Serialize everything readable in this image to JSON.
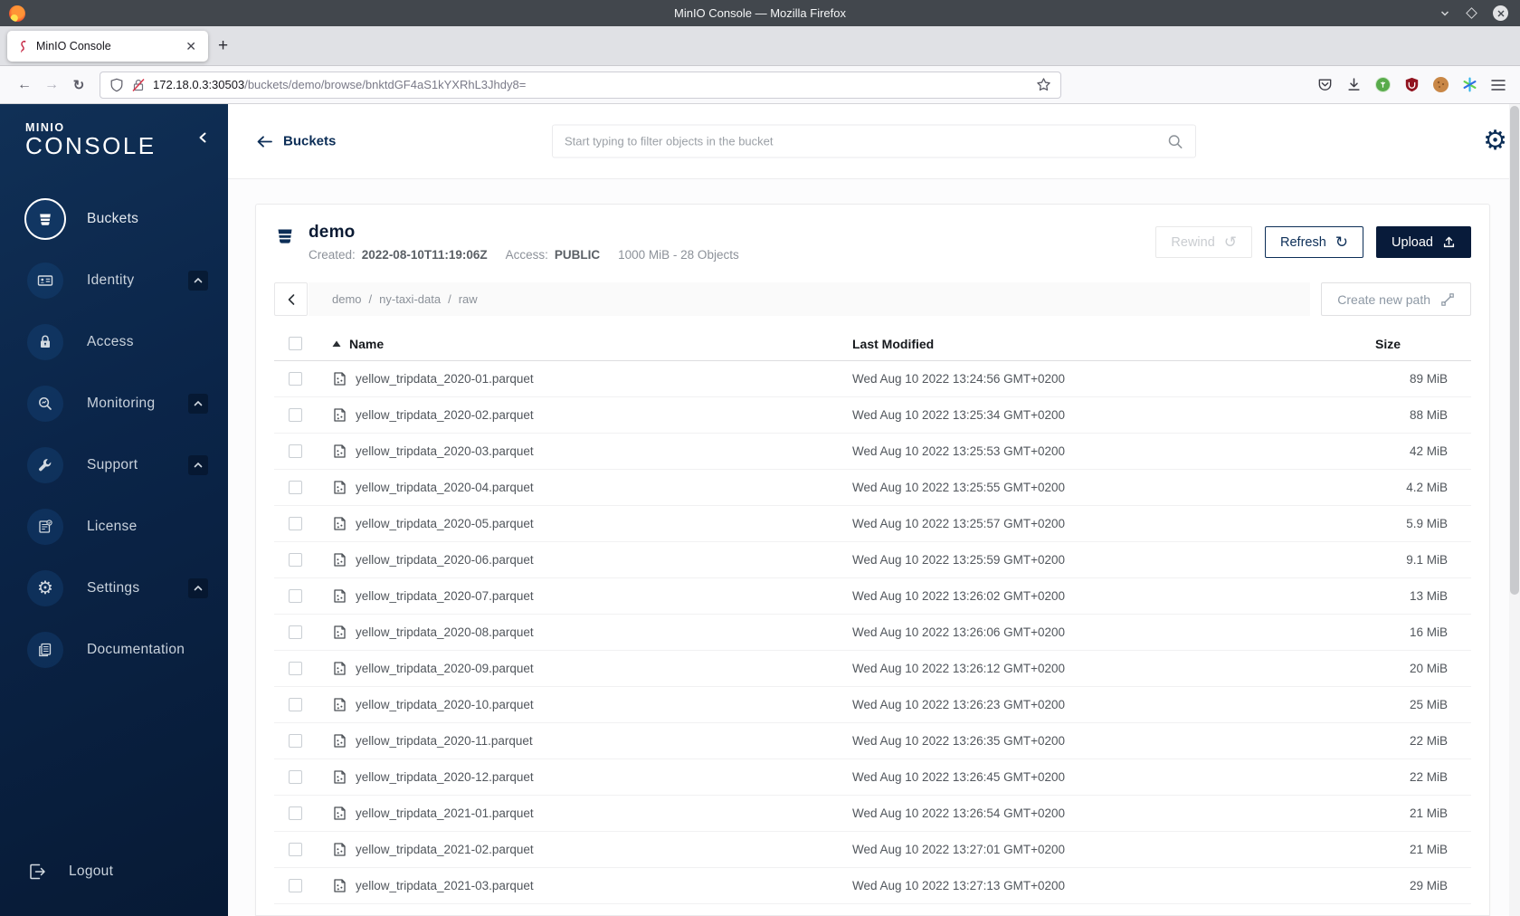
{
  "window": {
    "title": "MinIO Console — Mozilla Firefox"
  },
  "browser": {
    "tab_title": "MinIO Console",
    "url_host": "172.18.0.3:30503",
    "url_path": "/buckets/demo/browse/bnktdGF4aS1kYXRhL3Jhdy8=",
    "toolbar_icon_names": [
      "shield-permissions",
      "insecure-lock",
      "bookmark-star",
      "save-to-pocket",
      "downloads",
      "green-extension",
      "ublock-origin-extension",
      "cookie-extension",
      "sparkle-extension",
      "open-application-menu"
    ]
  },
  "sidebar": {
    "logo_line1": "MINIO",
    "logo_line2": "CONSOLE",
    "items": [
      {
        "label": "Buckets",
        "icon": "bucket-icon",
        "active": true,
        "expandable": false
      },
      {
        "label": "Identity",
        "icon": "id-card-icon",
        "active": false,
        "expandable": true
      },
      {
        "label": "Access",
        "icon": "lock-icon",
        "active": false,
        "expandable": false
      },
      {
        "label": "Monitoring",
        "icon": "monitor-magnifier-icon",
        "active": false,
        "expandable": true
      },
      {
        "label": "Support",
        "icon": "wrench-icon",
        "active": false,
        "expandable": true
      },
      {
        "label": "License",
        "icon": "license-doc-icon",
        "active": false,
        "expandable": false
      },
      {
        "label": "Settings",
        "icon": "gear-icon",
        "active": false,
        "expandable": true
      },
      {
        "label": "Documentation",
        "icon": "documentation-icon",
        "active": false,
        "expandable": false
      }
    ],
    "logout_label": "Logout"
  },
  "header": {
    "back_label": "Buckets",
    "search_placeholder": "Start typing to filter objects in the bucket"
  },
  "bucket": {
    "name": "demo",
    "created_label": "Created:",
    "created_value": "2022-08-10T11:19:06Z",
    "access_label": "Access:",
    "access_value": "PUBLIC",
    "usage": "1000 MiB - 28 Objects",
    "rewind_label": "Rewind",
    "refresh_label": "Refresh",
    "upload_label": "Upload"
  },
  "browse": {
    "breadcrumb": [
      "demo",
      "ny-taxi-data",
      "raw"
    ],
    "create_path_label": "Create new path"
  },
  "table": {
    "columns": {
      "name": "Name",
      "modified": "Last Modified",
      "size": "Size"
    },
    "rows": [
      {
        "name": "yellow_tripdata_2020-01.parquet",
        "modified": "Wed Aug 10 2022 13:24:56 GMT+0200",
        "size": "89 MiB"
      },
      {
        "name": "yellow_tripdata_2020-02.parquet",
        "modified": "Wed Aug 10 2022 13:25:34 GMT+0200",
        "size": "88 MiB"
      },
      {
        "name": "yellow_tripdata_2020-03.parquet",
        "modified": "Wed Aug 10 2022 13:25:53 GMT+0200",
        "size": "42 MiB"
      },
      {
        "name": "yellow_tripdata_2020-04.parquet",
        "modified": "Wed Aug 10 2022 13:25:55 GMT+0200",
        "size": "4.2 MiB"
      },
      {
        "name": "yellow_tripdata_2020-05.parquet",
        "modified": "Wed Aug 10 2022 13:25:57 GMT+0200",
        "size": "5.9 MiB"
      },
      {
        "name": "yellow_tripdata_2020-06.parquet",
        "modified": "Wed Aug 10 2022 13:25:59 GMT+0200",
        "size": "9.1 MiB"
      },
      {
        "name": "yellow_tripdata_2020-07.parquet",
        "modified": "Wed Aug 10 2022 13:26:02 GMT+0200",
        "size": "13 MiB"
      },
      {
        "name": "yellow_tripdata_2020-08.parquet",
        "modified": "Wed Aug 10 2022 13:26:06 GMT+0200",
        "size": "16 MiB"
      },
      {
        "name": "yellow_tripdata_2020-09.parquet",
        "modified": "Wed Aug 10 2022 13:26:12 GMT+0200",
        "size": "20 MiB"
      },
      {
        "name": "yellow_tripdata_2020-10.parquet",
        "modified": "Wed Aug 10 2022 13:26:23 GMT+0200",
        "size": "25 MiB"
      },
      {
        "name": "yellow_tripdata_2020-11.parquet",
        "modified": "Wed Aug 10 2022 13:26:35 GMT+0200",
        "size": "22 MiB"
      },
      {
        "name": "yellow_tripdata_2020-12.parquet",
        "modified": "Wed Aug 10 2022 13:26:45 GMT+0200",
        "size": "22 MiB"
      },
      {
        "name": "yellow_tripdata_2021-01.parquet",
        "modified": "Wed Aug 10 2022 13:26:54 GMT+0200",
        "size": "21 MiB"
      },
      {
        "name": "yellow_tripdata_2021-02.parquet",
        "modified": "Wed Aug 10 2022 13:27:01 GMT+0200",
        "size": "21 MiB"
      },
      {
        "name": "yellow_tripdata_2021-03.parquet",
        "modified": "Wed Aug 10 2022 13:27:13 GMT+0200",
        "size": "29 MiB"
      }
    ]
  },
  "colors": {
    "accent_navy": "#0c2e57",
    "button_navy": "#081b3a",
    "sidebar_top": "#103056",
    "sidebar_bottom": "#071a35",
    "titlebar": "#42474d"
  }
}
